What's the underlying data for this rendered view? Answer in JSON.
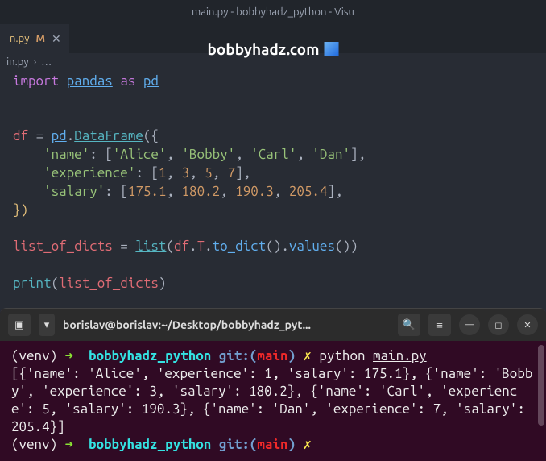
{
  "window": {
    "title": "main.py - bobbyhadz_python - Visu"
  },
  "tab": {
    "name": "n.py",
    "modified_marker": "M",
    "close_glyph": "✕"
  },
  "watermark": {
    "text": "bobbyhadz.com"
  },
  "breadcrumb": {
    "file": "in.py",
    "sep": "›",
    "more": "…"
  },
  "code": {
    "l1": {
      "import": "import",
      "pandas": "pandas",
      "as": "as",
      "pd": "pd"
    },
    "l3": {
      "df": "df",
      "eq": "=",
      "pd": "pd",
      "dot": ".",
      "DataFrame": "DataFrame",
      "open": "({"
    },
    "l4": {
      "key": "'name'",
      "colon": ":",
      "ob": "[",
      "v1": "'Alice'",
      "v2": "'Bobby'",
      "v3": "'Carl'",
      "v4": "'Dan'",
      "cb": "],",
      "c": ","
    },
    "l5": {
      "key": "'experience'",
      "colon": ":",
      "ob": "[",
      "v1": "1",
      "v2": "3",
      "v3": "5",
      "v4": "7",
      "cb": "],",
      "c": ","
    },
    "l6": {
      "key": "'salary'",
      "colon": ":",
      "ob": "[",
      "v1": "175.1",
      "v2": "180.2",
      "v3": "190.3",
      "v4": "205.4",
      "cb": "],",
      "c": ","
    },
    "l7": {
      "close": "})"
    },
    "l9": {
      "var": "list_of_dicts",
      "eq": "=",
      "list": "list",
      "open": "(",
      "df": "df",
      "dot1": ".",
      "T": "T",
      "dot2": ".",
      "to_dict": "to_dict",
      "p1": "()",
      "dot3": ".",
      "values": "values",
      "p2": "()",
      "close": ")"
    },
    "l11": {
      "print": "print",
      "open": "(",
      "arg": "list_of_dicts",
      "close": ")"
    }
  },
  "terminal": {
    "title": "borislav@borislav:~/Desktop/bobbyhadz_pyt...",
    "venv": "(venv)",
    "arrow": "➜",
    "dir": "bobbyhadz_python",
    "git": "git:(",
    "branch": "main",
    "gitclose": ")",
    "dirty": "✗",
    "cmd_python": "python",
    "cmd_file": "main.py",
    "output": "[{'name': 'Alice', 'experience': 1, 'salary': 175.1}, {'name': 'Bobby', 'experience': 3, 'salary': 180.2}, {'name': 'Carl', 'experience': 5, 'salary': 190.3}, {'name': 'Dan', 'experience': 7, 'salary': 205.4}]"
  },
  "icons": {
    "new_tab": "▾",
    "search": "🔍",
    "menu": "≡",
    "minimize": "—",
    "maximize": "◻",
    "close": "✕",
    "term_box": "▣"
  }
}
